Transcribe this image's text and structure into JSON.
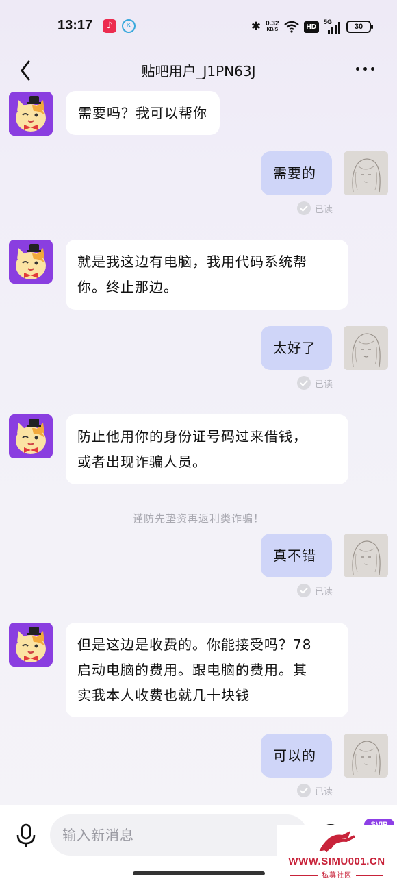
{
  "status_bar": {
    "time": "13:17",
    "music_app_icon": "music-note-icon",
    "k_app_label": "K",
    "net_speed_value": "0.32",
    "net_speed_unit": "KB/S",
    "hd_label": "HD",
    "signal_label": "5G",
    "battery": "30"
  },
  "header": {
    "title": "贴吧用户_J1PN63J"
  },
  "messages": [
    {
      "side": "in",
      "text": "需要吗？我可以帮你"
    },
    {
      "side": "out",
      "text": "需要的",
      "status": "已读"
    },
    {
      "side": "in",
      "line1": "就是我这边有电脑，我用代码系统帮",
      "line2": "你。终止那边。"
    },
    {
      "side": "out",
      "text": "太好了",
      "status": "已读"
    },
    {
      "side": "in",
      "line1": "防止他用你的身份证号码过来借钱，",
      "line2": "或者出现诈骗人员。"
    },
    {
      "side": "out",
      "text": "真不错",
      "status": "已读"
    },
    {
      "side": "in",
      "line1": "但是这边是收费的。你能接受吗？78",
      "line2": "启动电脑的费用。跟电脑的费用。其",
      "line3": "实我本人收费也就几十块钱"
    },
    {
      "side": "out",
      "text": "可以的",
      "status": "已读"
    }
  ],
  "notice": "谨防先垫资再返利类诈骗！",
  "input": {
    "placeholder": "输入新消息"
  },
  "svip_badge": "SVIP",
  "watermark": {
    "url": "WWW.SIMU001.CN",
    "subtitle": "私募社区"
  },
  "colors": {
    "outgoing_bubble": "#cfd5f8",
    "incoming_bubble": "#ffffff",
    "avatar_purple": "#8a3ee0",
    "watermark_red": "#c8233a"
  }
}
